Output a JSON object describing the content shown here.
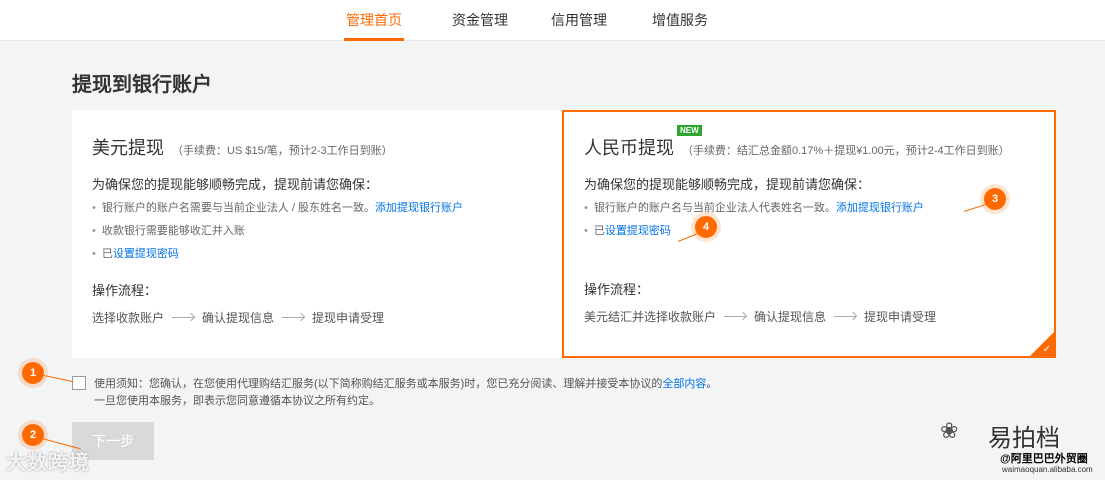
{
  "nav": {
    "tabs": [
      {
        "label": "管理首页",
        "active": true
      },
      {
        "label": "资金管理",
        "active": false
      },
      {
        "label": "信用管理",
        "active": false
      },
      {
        "label": "增值服务",
        "active": false
      }
    ]
  },
  "page": {
    "title": "提现到银行账户"
  },
  "usd_card": {
    "title": "美元提现",
    "fee": "（手续费：US $15/笔，预计2-3工作日到账）",
    "intro": "为确保您的提现能够顺畅完成，提现前请您确保：",
    "item1_text": "银行账户的账户名需要与当前企业法人 / 股东姓名一致。",
    "item1_link": "添加提现银行账户",
    "item2_text": "收款银行需要能够收汇并入账",
    "item3_prefix": "已",
    "item3_link": "设置提现密码",
    "flow_label": "操作流程：",
    "flow_steps": [
      "选择收款账户",
      "确认提现信息",
      "提现申请受理"
    ]
  },
  "rmb_card": {
    "badge": "NEW",
    "title": "人民币提现",
    "fee": "（手续费：结汇总金额0.17%＋提现¥1.00元，预计2-4工作日到账）",
    "intro": "为确保您的提现能够顺畅完成，提现前请您确保：",
    "item1_text": "银行账户的账户名与当前企业法人代表姓名一致。",
    "item1_link": "添加提现银行账户",
    "item2_prefix": "已",
    "item2_link": "设置提现密码",
    "flow_label": "操作流程：",
    "flow_steps": [
      "美元结汇并选择收款账户",
      "确认提现信息",
      "提现申请受理"
    ],
    "selected": true
  },
  "agreement": {
    "line1": "使用须知：您确认，在您使用代理购结汇服务(以下简称购结汇服务或本服务)时，您已充分阅读、理解并接受本协议的",
    "link": "全部内容",
    "line1_end": "。",
    "line2": "一旦您使用本服务，即表示您同意遵循本协议之所有约定。",
    "checked": false
  },
  "next_button": {
    "label": "下一步",
    "enabled": false
  },
  "markers": [
    "1",
    "2",
    "3",
    "4"
  ],
  "watermark": {
    "left_text": "大数跨境",
    "right_brand": "易拍档",
    "right_name": "@阿里巴巴外贸圈",
    "right_url": "waimaoquan.alibaba.com"
  },
  "colors": {
    "accent": "#ff6a00",
    "link": "#0073e6",
    "badge": "#2ea52e"
  }
}
